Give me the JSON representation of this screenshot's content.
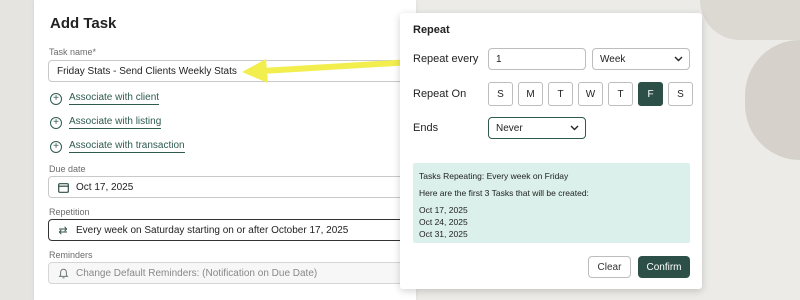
{
  "add_task": {
    "title": "Add Task",
    "task_name_label": "Task name*",
    "task_name_value": "Friday Stats - Send Clients Weekly Stats",
    "associate_client": "Associate with client",
    "associate_listing": "Associate with listing",
    "associate_transaction": "Associate with transaction",
    "due_date_label": "Due date",
    "due_date_value": "Oct 17, 2025",
    "repetition_label": "Repetition",
    "repetition_value": "Every week on Saturday starting on or after October 17, 2025",
    "reminders_label": "Reminders",
    "reminders_value": "Change Default Reminders: (Notification on Due Date)"
  },
  "repeat": {
    "title": "Repeat",
    "repeat_every_label": "Repeat every",
    "repeat_every_value": "1",
    "unit_value": "Week",
    "repeat_on_label": "Repeat On",
    "days": [
      "S",
      "M",
      "T",
      "W",
      "T",
      "F",
      "S"
    ],
    "selected_day": "F",
    "ends_label": "Ends",
    "ends_value": "Never",
    "summary_title": "Tasks Repeating: Every week on Friday",
    "summary_intro": "Here are the first 3 Tasks that will be created:",
    "dates": [
      "Oct 17, 2025",
      "Oct 24, 2025",
      "Oct 31, 2025"
    ],
    "clear_label": "Clear",
    "confirm_label": "Confirm"
  },
  "icons": {
    "calendar": "calendar-icon",
    "repeat": "repeat-icon",
    "bell": "bell-icon",
    "plus": "plus-circle-icon",
    "chevron": "chevron-down-icon"
  },
  "colors": {
    "accent": "#2c4f47",
    "summary_bg": "#dbf0ea",
    "arrow": "#f2ee4e",
    "error": "#d33344"
  }
}
